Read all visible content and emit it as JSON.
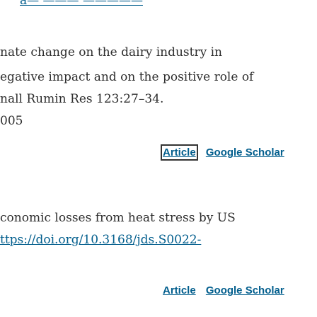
{
  "top_fragment": "a—  ——— —————",
  "reference_1": {
    "line1": "nate change on the dairy industry in",
    "line2": "egative impact and on the positive role of",
    "line3": "nall Rumin Res 123:27–34.",
    "line4": "005",
    "article_link": "Article",
    "scholar_link": "Google Scholar"
  },
  "reference_2": {
    "line1": "conomic losses from heat stress by US",
    "doi": "ttps://doi.org/10.3168/jds.S0022-",
    "article_link": "Article",
    "scholar_link": "Google Scholar"
  },
  "colors": {
    "link": "#025e8d",
    "text": "#2e2e2e"
  }
}
